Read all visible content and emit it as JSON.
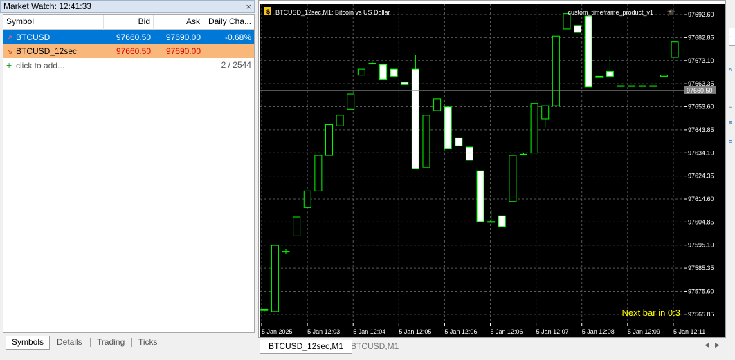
{
  "market_watch": {
    "title": "Market Watch: 12:41:33",
    "close_glyph": "×",
    "columns": [
      "Symbol",
      "Bid",
      "Ask",
      "Daily Cha..."
    ],
    "rows": [
      {
        "arrow": "↗",
        "symbol": "BTCUSD",
        "bid": "97660.50",
        "ask": "97690.00",
        "change": "-0.68%"
      },
      {
        "arrow": "↘",
        "symbol": "BTCUSD_12sec",
        "bid": "97660.50",
        "ask": "97690.00",
        "change": ""
      }
    ],
    "add_row": {
      "icon": "plus-icon",
      "label": "click to add...",
      "count": "2 / 2544"
    },
    "tabs": [
      "Symbols",
      "Details",
      "Trading",
      "Ticks"
    ]
  },
  "chart": {
    "header": "BTCUSD_12sec,M1:  Bitcoin vs US Dollar",
    "indicator": "custom_timeframe_product_v1",
    "next_bar": "Next bar in 0:3",
    "current_price": "97660.50",
    "price_labels": [
      "97692.60",
      "97682.85",
      "97673.10",
      "97663.35",
      "97653.60",
      "97643.85",
      "97634.10",
      "97624.35",
      "97614.60",
      "97604.85",
      "97595.10",
      "97585.35",
      "97575.60",
      "97565.85"
    ],
    "time_labels": [
      "5 Jan 2025",
      "5 Jan 12:03",
      "5 Jan 12:04",
      "5 Jan 12:05",
      "5 Jan 12:06",
      "5 Jan 12:06",
      "5 Jan 12:07",
      "5 Jan 12:08",
      "5 Jan 12:09",
      "5 Jan 12:11"
    ],
    "tabs": [
      "BTCUSD_12sec,M1",
      "BTCUSD,M1"
    ],
    "colors": {
      "background": "#000000",
      "bull": "#00ff00",
      "bear_body": "#ffffff",
      "grid": "#5a5a5a",
      "text": "#ffffff",
      "next_bar": "#ffff00"
    }
  },
  "chart_data": {
    "type": "candlestick",
    "ylim": [
      97562,
      97697
    ],
    "candles": [
      {
        "o": 97568.0,
        "h": 97568.0,
        "l": 97567.0,
        "c": 97567.5
      },
      {
        "o": 97567.0,
        "h": 97595.0,
        "l": 97567.0,
        "c": 97595.0
      },
      {
        "o": 97592.5,
        "h": 97593.5,
        "l": 97591.5,
        "c": 97592.5
      },
      {
        "o": 97599.0,
        "h": 97607.0,
        "l": 97599.0,
        "c": 97607.0
      },
      {
        "o": 97611.0,
        "h": 97618.0,
        "l": 97611.0,
        "c": 97618.0
      },
      {
        "o": 97618.0,
        "h": 97633.0,
        "l": 97618.0,
        "c": 97633.0
      },
      {
        "o": 97633.0,
        "h": 97646.0,
        "l": 97633.0,
        "c": 97646.0
      },
      {
        "o": 97645.5,
        "h": 97650.0,
        "l": 97645.5,
        "c": 97650.0
      },
      {
        "o": 97652.5,
        "h": 97659.0,
        "l": 97652.5,
        "c": 97659.0
      },
      {
        "o": 97667.0,
        "h": 97669.5,
        "l": 97667.0,
        "c": 97669.5
      },
      {
        "o": 97672.0,
        "h": 97672.5,
        "l": 97672.0,
        "c": 97672.0
      },
      {
        "o": 97671.5,
        "h": 97671.5,
        "l": 97665.0,
        "c": 97665.0
      },
      {
        "o": 97669.5,
        "h": 97669.5,
        "l": 97666.5,
        "c": 97666.5
      },
      {
        "o": 97664.0,
        "h": 97664.0,
        "l": 97663.0,
        "c": 97663.0
      },
      {
        "o": 97669.5,
        "h": 97675.5,
        "l": 97627.5,
        "c": 97627.5
      },
      {
        "o": 97628.0,
        "h": 97650.0,
        "l": 97628.0,
        "c": 97650.0
      },
      {
        "o": 97652.0,
        "h": 97657.0,
        "l": 97652.0,
        "c": 97657.0
      },
      {
        "o": 97653.5,
        "h": 97653.5,
        "l": 97636.0,
        "c": 97636.0
      },
      {
        "o": 97640.5,
        "h": 97640.5,
        "l": 97637.0,
        "c": 97637.0
      },
      {
        "o": 97636.5,
        "h": 97636.5,
        "l": 97631.0,
        "c": 97631.0
      },
      {
        "o": 97626.5,
        "h": 97626.5,
        "l": 97605.0,
        "c": 97605.0
      },
      {
        "o": 97605.0,
        "h": 97610.0,
        "l": 97605.0,
        "c": 97605.0
      },
      {
        "o": 97607.5,
        "h": 97607.5,
        "l": 97603.0,
        "c": 97603.0
      },
      {
        "o": 97613.5,
        "h": 97633.0,
        "l": 97613.5,
        "c": 97633.0
      },
      {
        "o": 97633.5,
        "h": 97634.0,
        "l": 97633.0,
        "c": 97633.5
      },
      {
        "o": 97634.0,
        "h": 97655.0,
        "l": 97634.0,
        "c": 97655.0
      },
      {
        "o": 97648.5,
        "h": 97654.0,
        "l": 97645.0,
        "c": 97654.0
      },
      {
        "o": 97654.0,
        "h": 97683.5,
        "l": 97654.0,
        "c": 97683.5
      },
      {
        "o": 97686.5,
        "h": 97693.0,
        "l": 97686.5,
        "c": 97693.0
      },
      {
        "o": 97688.0,
        "h": 97688.0,
        "l": 97685.0,
        "c": 97685.0
      },
      {
        "o": 97692.0,
        "h": 97692.0,
        "l": 97662.0,
        "c": 97662.0
      },
      {
        "o": 97666.5,
        "h": 97666.5,
        "l": 97666.0,
        "c": 97666.0
      },
      {
        "o": 97668.5,
        "h": 97675.0,
        "l": 97666.5,
        "c": 97666.5
      },
      {
        "o": 97662.5,
        "h": 97662.5,
        "l": 97662.5,
        "c": 97662.5
      },
      {
        "o": 97662.5,
        "h": 97662.5,
        "l": 97662.5,
        "c": 97662.5
      },
      {
        "o": 97662.5,
        "h": 97662.5,
        "l": 97662.5,
        "c": 97662.5
      },
      {
        "o": 97662.5,
        "h": 97662.5,
        "l": 97662.5,
        "c": 97662.5
      },
      {
        "o": 97666.5,
        "h": 97667.0,
        "l": 97666.5,
        "c": 97667.0
      },
      {
        "o": 97674.5,
        "h": 97681.0,
        "l": 97674.5,
        "c": 97681.0
      }
    ]
  }
}
